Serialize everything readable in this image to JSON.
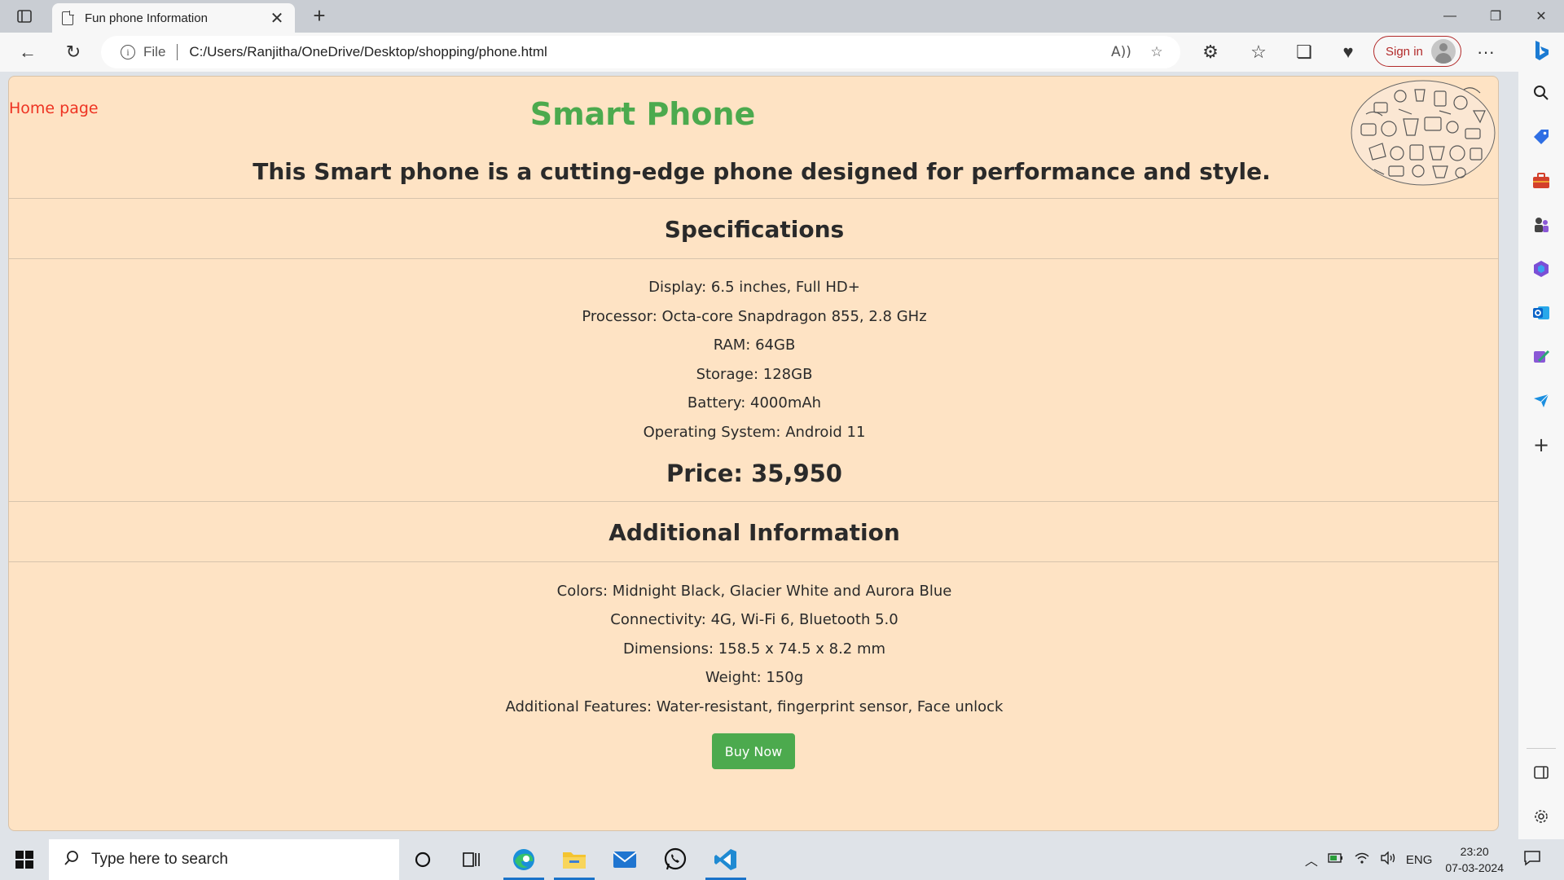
{
  "browser": {
    "tab_title": "Fun phone Information",
    "address_scheme": "File",
    "address_url": "C:/Users/Ranjitha/OneDrive/Desktop/shopping/phone.html",
    "signin_label": "Sign in"
  },
  "page": {
    "home_link": "Home page",
    "title": "Smart Phone",
    "subtitle": "This Smart phone is a cutting-edge phone designed for performance and style.",
    "specs_heading": "Specifications",
    "specs": [
      "Display: 6.5 inches, Full HD+",
      "Processor: Octa-core Snapdragon 855, 2.8 GHz",
      "RAM: 64GB",
      "Storage: 128GB",
      "Battery: 4000mAh",
      "Operating System: Android 11"
    ],
    "price": "Price: 35,950",
    "additional_heading": "Additional Information",
    "additional": [
      "Colors: Midnight Black, Glacier White and Aurora Blue",
      "Connectivity: 4G, Wi-Fi 6, Bluetooth 5.0",
      "Dimensions: 158.5 x 74.5 x 8.2 mm",
      "Weight: 150g",
      "Additional Features: Water-resistant, fingerprint sensor, Face unlock"
    ],
    "buy_button": "Buy Now",
    "colors": {
      "background": "#fee3c4",
      "title_green": "#4caa4e",
      "link_red": "#ee3322",
      "button_green": "#4caa4e"
    }
  },
  "taskbar": {
    "search_placeholder": "Type here to search",
    "language": "ENG",
    "time": "23:20",
    "date": "07-03-2024"
  }
}
